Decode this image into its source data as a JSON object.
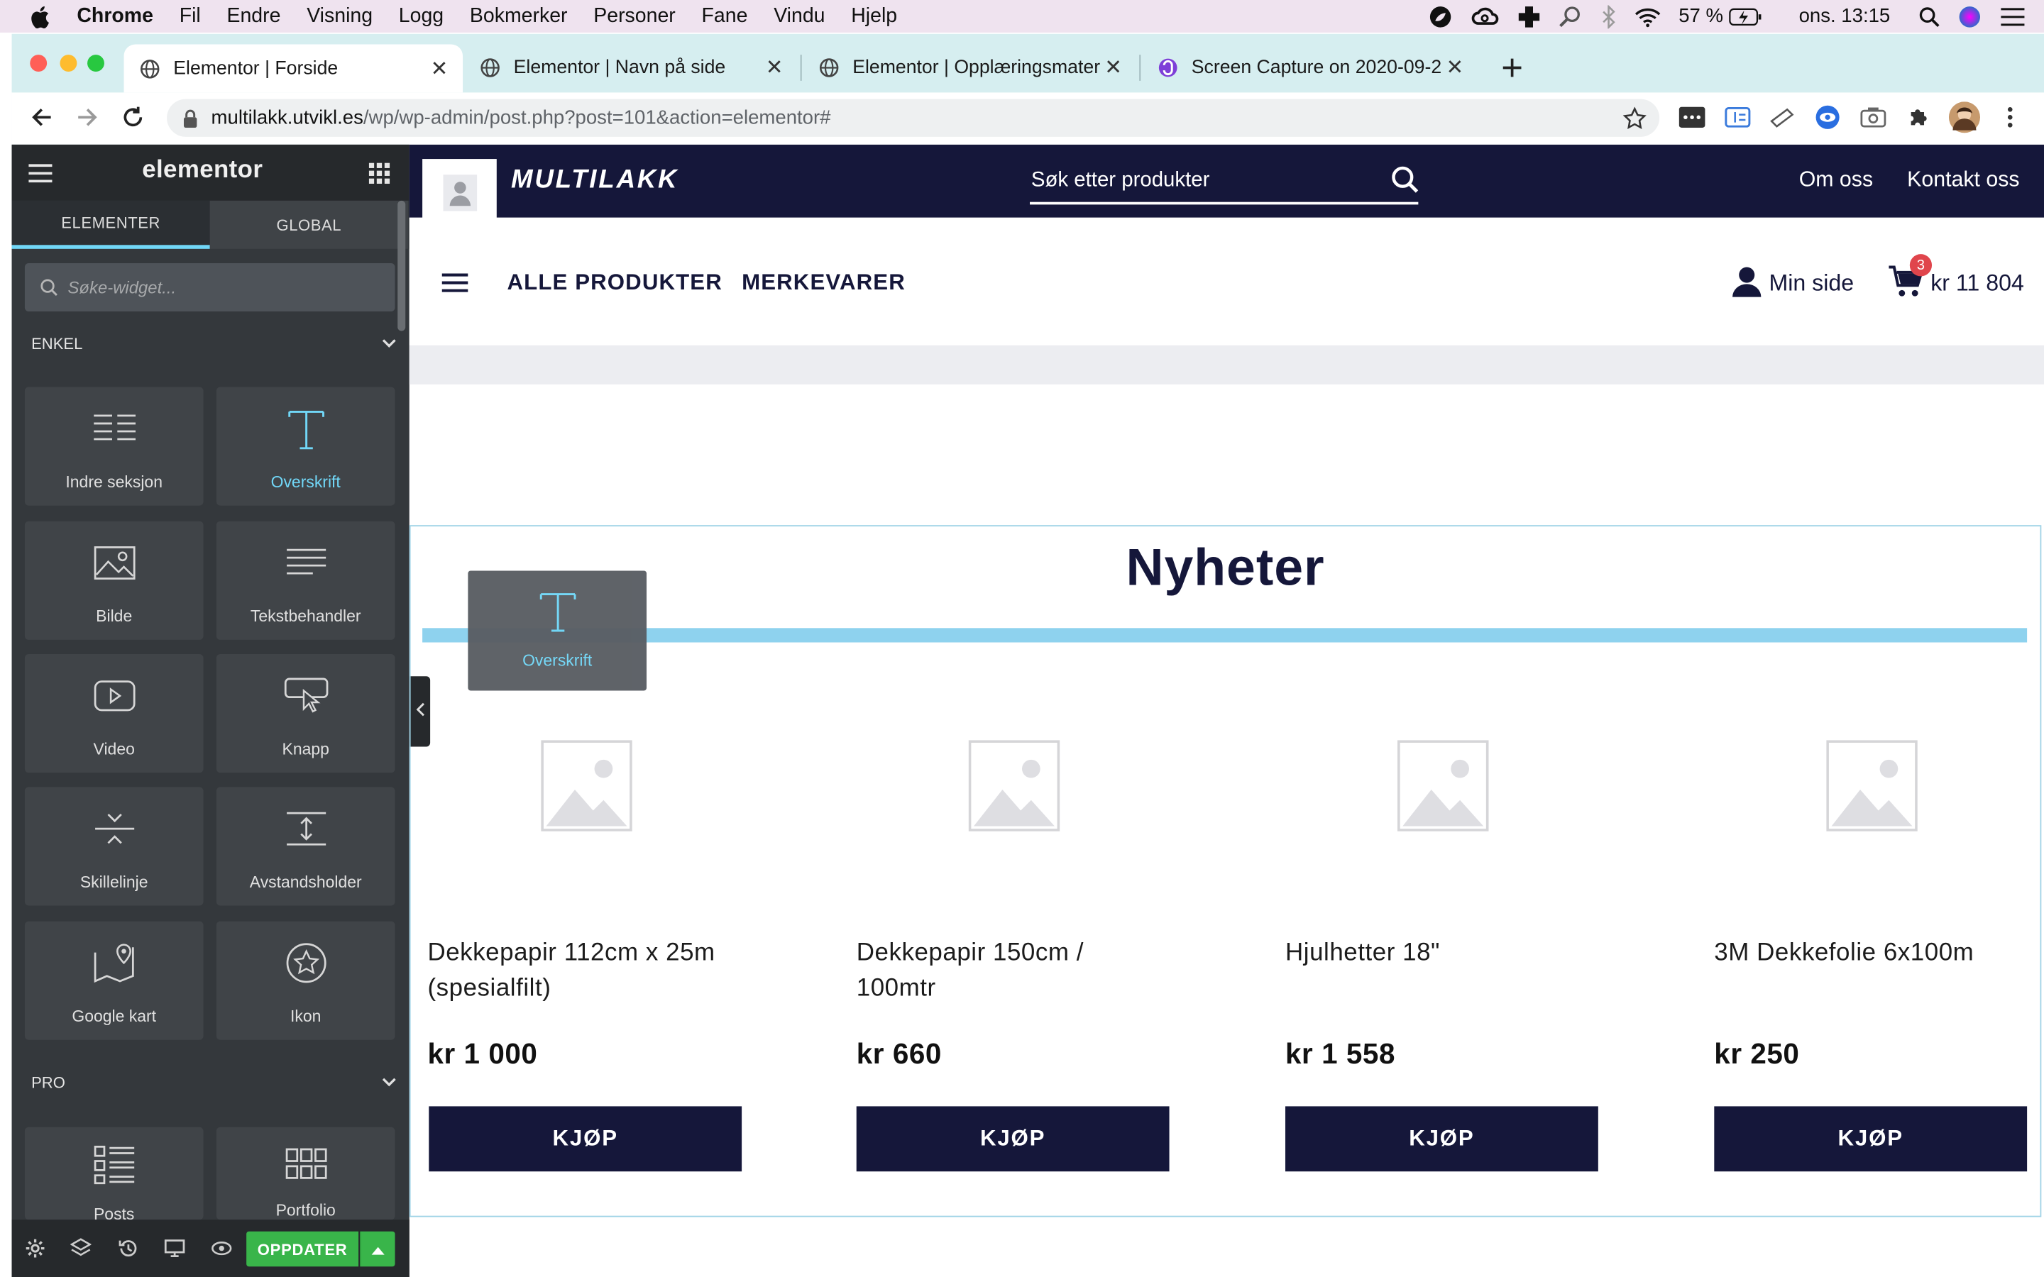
{
  "menubar": {
    "app": "Chrome",
    "items": [
      "Fil",
      "Endre",
      "Visning",
      "Logg",
      "Bokmerker",
      "Personer",
      "Fane",
      "Vindu",
      "Hjelp"
    ],
    "battery": "57 %",
    "clock": "ons. 13:15"
  },
  "tabs": [
    {
      "label": "Elementor | Forside"
    },
    {
      "label": "Elementor | Navn på side"
    },
    {
      "label": "Elementor | Opplæringsmateriell"
    },
    {
      "label": "Screen Capture on 2020-09-2"
    }
  ],
  "address": {
    "host": "multilakk.utvikl.es",
    "path": "/wp/wp-admin/post.php?post=101&action=elementor#"
  },
  "panel": {
    "logo": "elementor",
    "tab_elements": "ELEMENTER",
    "tab_global": "GLOBAL",
    "search_placeholder": "Søke-widget...",
    "cat_basic": "ENKEL",
    "cat_pro": "PRO",
    "widgets": [
      {
        "label": "Indre seksjon",
        "icon": "inner-section-icon"
      },
      {
        "label": "Overskrift",
        "icon": "heading-icon"
      },
      {
        "label": "Bilde",
        "icon": "image-icon"
      },
      {
        "label": "Tekstbehandler",
        "icon": "text-editor-icon"
      },
      {
        "label": "Video",
        "icon": "video-icon"
      },
      {
        "label": "Knapp",
        "icon": "button-icon"
      },
      {
        "label": "Skillelinje",
        "icon": "divider-icon"
      },
      {
        "label": "Avstandsholder",
        "icon": "spacer-icon"
      },
      {
        "label": "Google kart",
        "icon": "map-icon"
      },
      {
        "label": "Ikon",
        "icon": "star-icon"
      }
    ],
    "pro_widgets": [
      {
        "label": "Posts",
        "icon": "posts-icon"
      },
      {
        "label": "Portfolio",
        "icon": "portfolio-icon"
      }
    ],
    "update_button": "OPPDATER",
    "accent": "#71d7f7",
    "update_color": "#39b54a"
  },
  "site": {
    "brand": "MULTILAKK",
    "search_placeholder": "Søk etter produkter",
    "top_links": [
      "Om oss",
      "Kontakt oss"
    ],
    "nav": [
      "ALLE PRODUKTER",
      "MERKEVARER"
    ],
    "account": "Min side",
    "cart_count": "3",
    "cart_total": "kr 11 804",
    "section_title": "Nyheter",
    "drag_widget": "Overskrift",
    "products": [
      {
        "name": "Dekkepapir 112cm x 25m (spesialfilt)",
        "price": "kr 1 000",
        "button": "KJØP"
      },
      {
        "name": "Dekkepapir 150cm / 100mtr",
        "price": "kr 660",
        "button": "KJØP"
      },
      {
        "name": "Hjulhetter 18\"",
        "price": "kr 1 558",
        "button": "KJØP"
      },
      {
        "name": "3M Dekkefolie 6x100m",
        "price": "kr 250",
        "button": "KJØP"
      }
    ],
    "navy": "#15173a"
  }
}
